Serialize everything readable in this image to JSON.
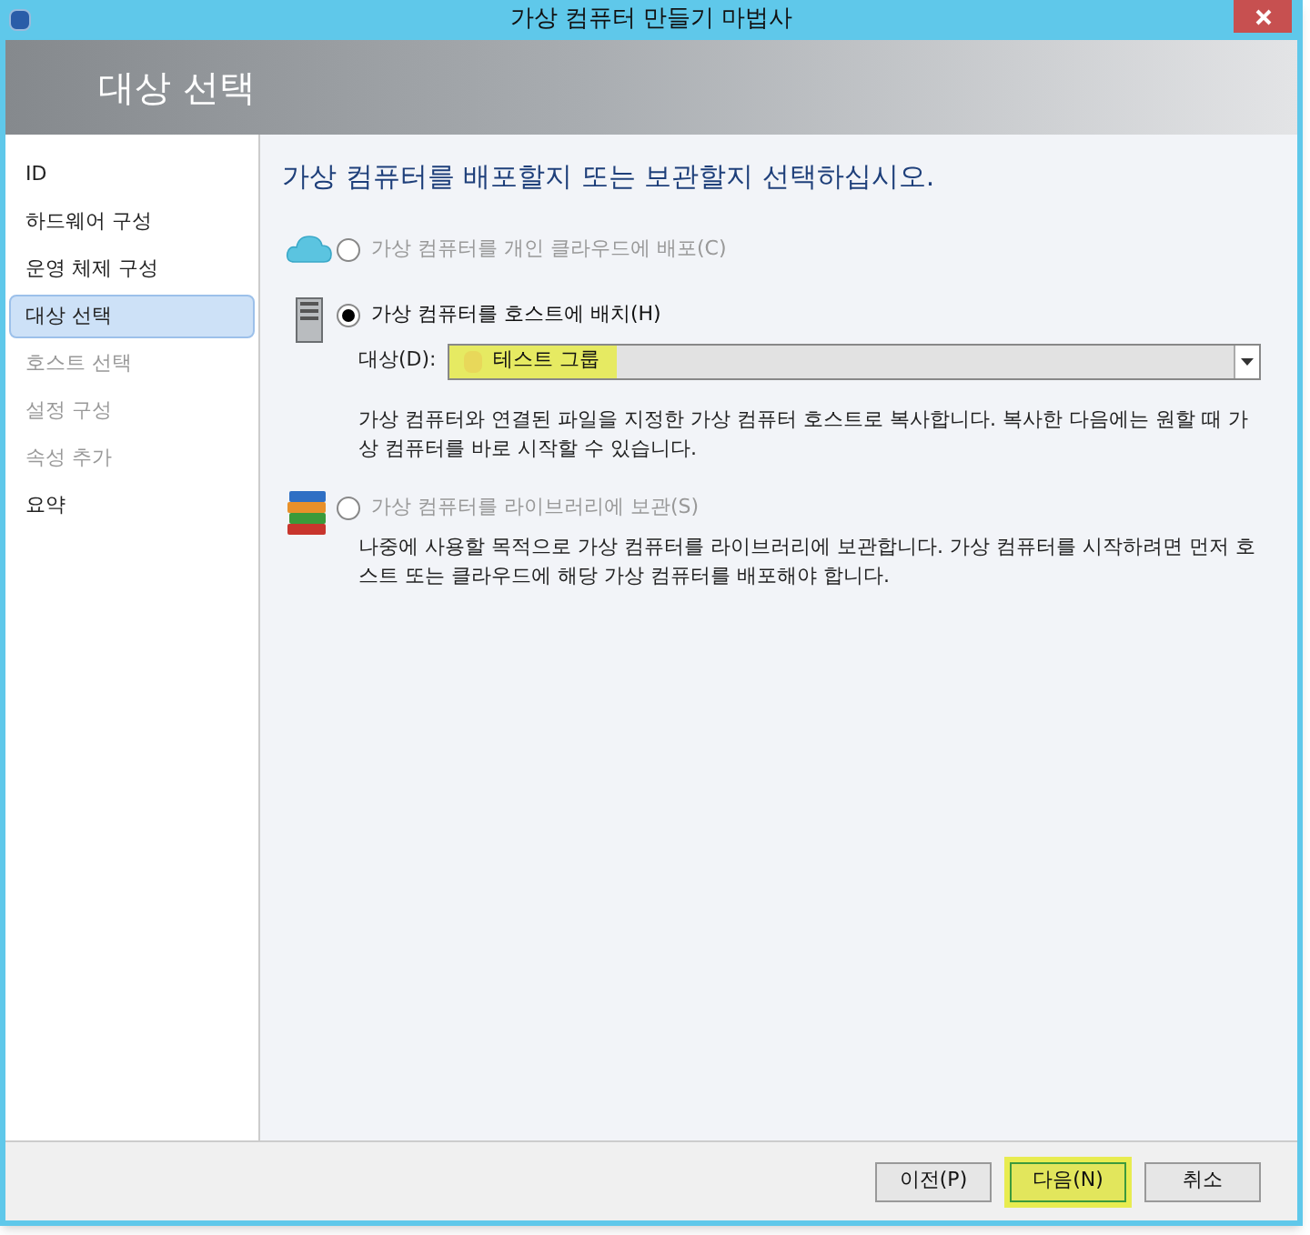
{
  "window": {
    "title": "가상 컴퓨터 만들기 마법사"
  },
  "header": {
    "title": "대상 선택"
  },
  "steps": [
    {
      "label": "ID",
      "selected": false,
      "disabled": false
    },
    {
      "label": "하드웨어 구성",
      "selected": false,
      "disabled": false
    },
    {
      "label": "운영 체제 구성",
      "selected": false,
      "disabled": false
    },
    {
      "label": "대상 선택",
      "selected": true,
      "disabled": false
    },
    {
      "label": "호스트 선택",
      "selected": false,
      "disabled": true
    },
    {
      "label": "설정 구성",
      "selected": false,
      "disabled": true
    },
    {
      "label": "속성 추가",
      "selected": false,
      "disabled": true
    },
    {
      "label": "요약",
      "selected": false,
      "disabled": false
    }
  ],
  "content": {
    "heading": "가상 컴퓨터를 배포할지 또는 보관할지 선택하십시오.",
    "options": [
      {
        "kind": "cloud",
        "label": "가상 컴퓨터를 개인 클라우드에 배포(C)",
        "selected": false,
        "disabled": true
      },
      {
        "kind": "server",
        "label": "가상 컴퓨터를 호스트에 배치(H)",
        "selected": true,
        "disabled": false,
        "target": {
          "label": "대상(D):",
          "value": "테스트 그룹",
          "highlighted": true
        },
        "description": "가상 컴퓨터와 연결된 파일을 지정한 가상 컴퓨터 호스트로 복사합니다. 복사한 다음에는 원할 때 가상 컴퓨터를 바로 시작할 수 있습니다."
      },
      {
        "kind": "books",
        "label": "가상 컴퓨터를 라이브러리에 보관(S)",
        "selected": false,
        "disabled": true,
        "description": "나중에 사용할 목적으로 가상 컴퓨터를 라이브러리에 보관합니다. 가상 컴퓨터를 시작하려면 먼저 호스트 또는 클라우드에 해당 가상 컴퓨터를 배포해야 합니다."
      }
    ]
  },
  "buttons": [
    {
      "label": "이전(P)",
      "highlighted": false
    },
    {
      "label": "다음(N)",
      "highlighted": true
    },
    {
      "label": "취소",
      "highlighted": false
    }
  ]
}
